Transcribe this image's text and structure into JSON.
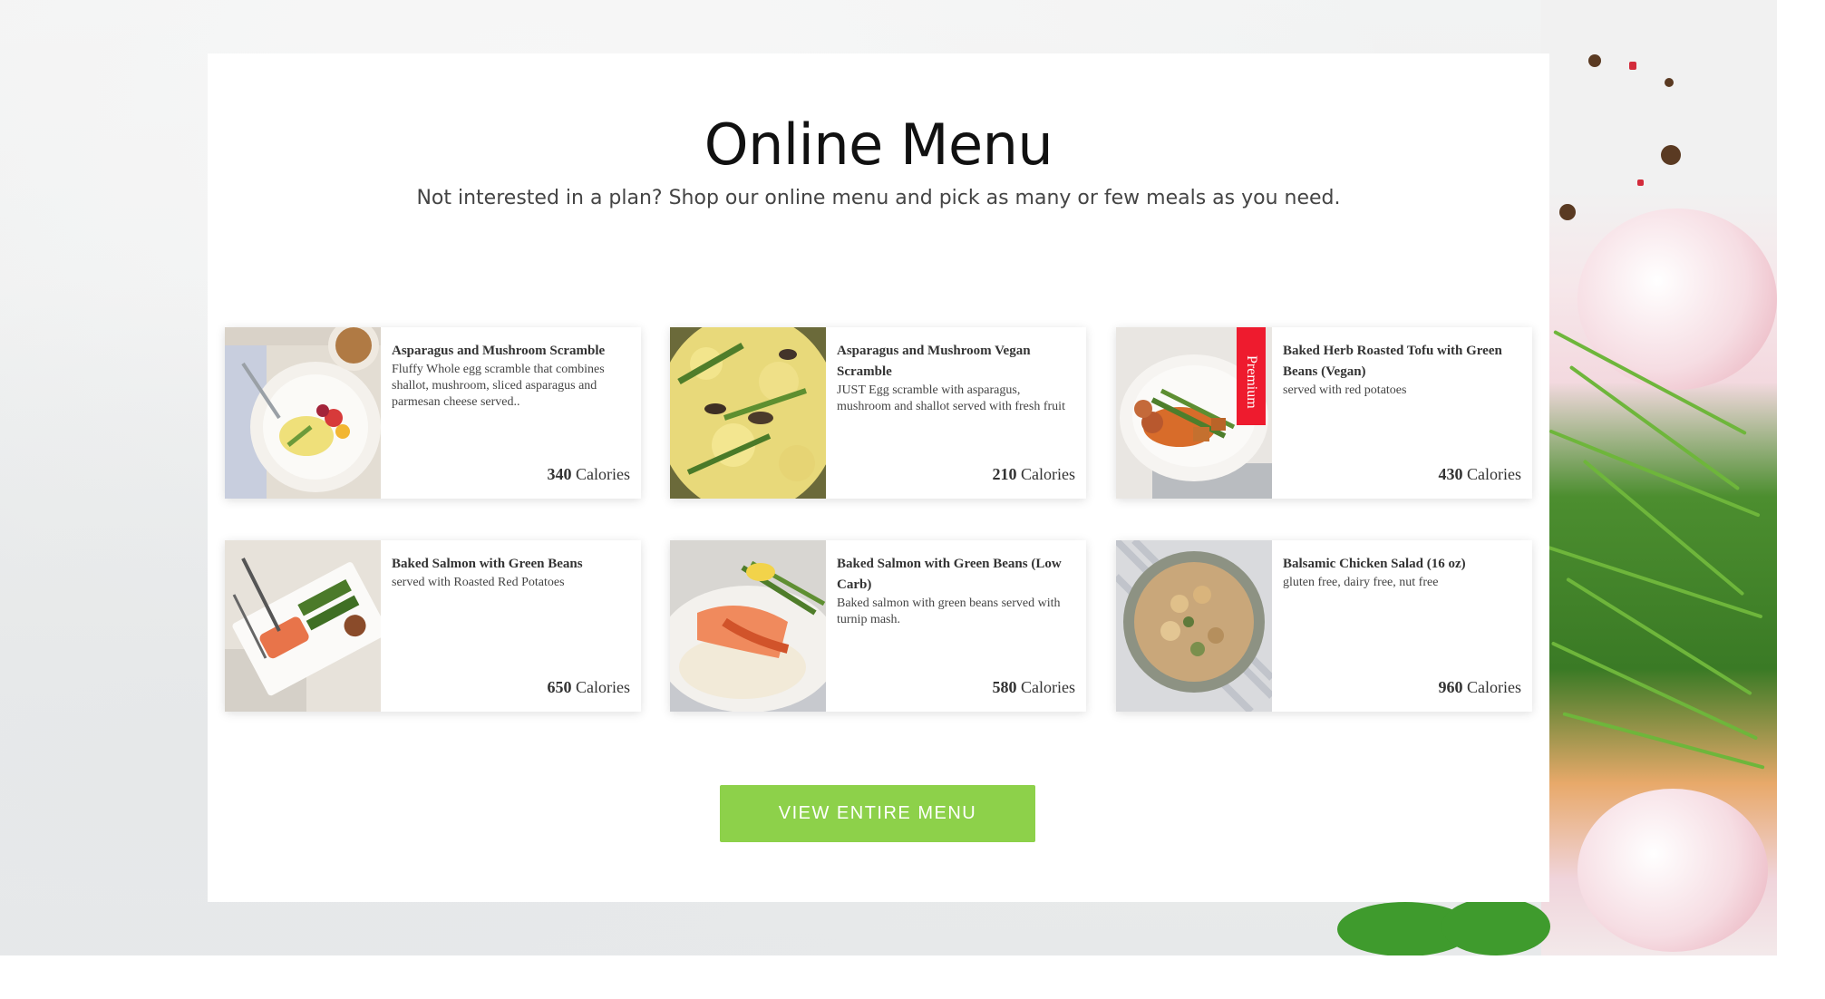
{
  "header": {
    "title": "Online Menu",
    "subtitle": "Not interested in a plan? Shop our online menu and pick as many or few meals as you need."
  },
  "items": [
    {
      "name": "Asparagus and Mushroom Scramble",
      "description": "Fluffy Whole egg scramble that combines shallot, mushroom, sliced asparagus and parmesan cheese served..",
      "calories": "340",
      "calories_label": "Calories"
    },
    {
      "name": "Asparagus and Mushroom Vegan Scramble",
      "description": "JUST Egg scramble with asparagus, mushroom and shallot served with fresh fruit",
      "calories": "210",
      "calories_label": "Calories"
    },
    {
      "name": "Baked Herb Roasted Tofu with Green Beans (Vegan)",
      "description": "served with red potatoes",
      "calories": "430",
      "calories_label": "Calories",
      "badge": "Premium"
    },
    {
      "name": "Baked Salmon with Green Beans",
      "description": "served with Roasted Red Potatoes",
      "calories": "650",
      "calories_label": "Calories"
    },
    {
      "name": "Baked Salmon with Green Beans (Low Carb)",
      "description": "Baked salmon with green beans served with turnip mash.",
      "calories": "580",
      "calories_label": "Calories"
    },
    {
      "name": "Balsamic Chicken Salad (16 oz)",
      "description": "gluten free, dairy free, nut free",
      "calories": "960",
      "calories_label": "Calories"
    }
  ],
  "cta": {
    "label": "VIEW ENTIRE MENU"
  },
  "colors": {
    "accent": "#8dd14a",
    "badge": "#ee1b2e"
  }
}
